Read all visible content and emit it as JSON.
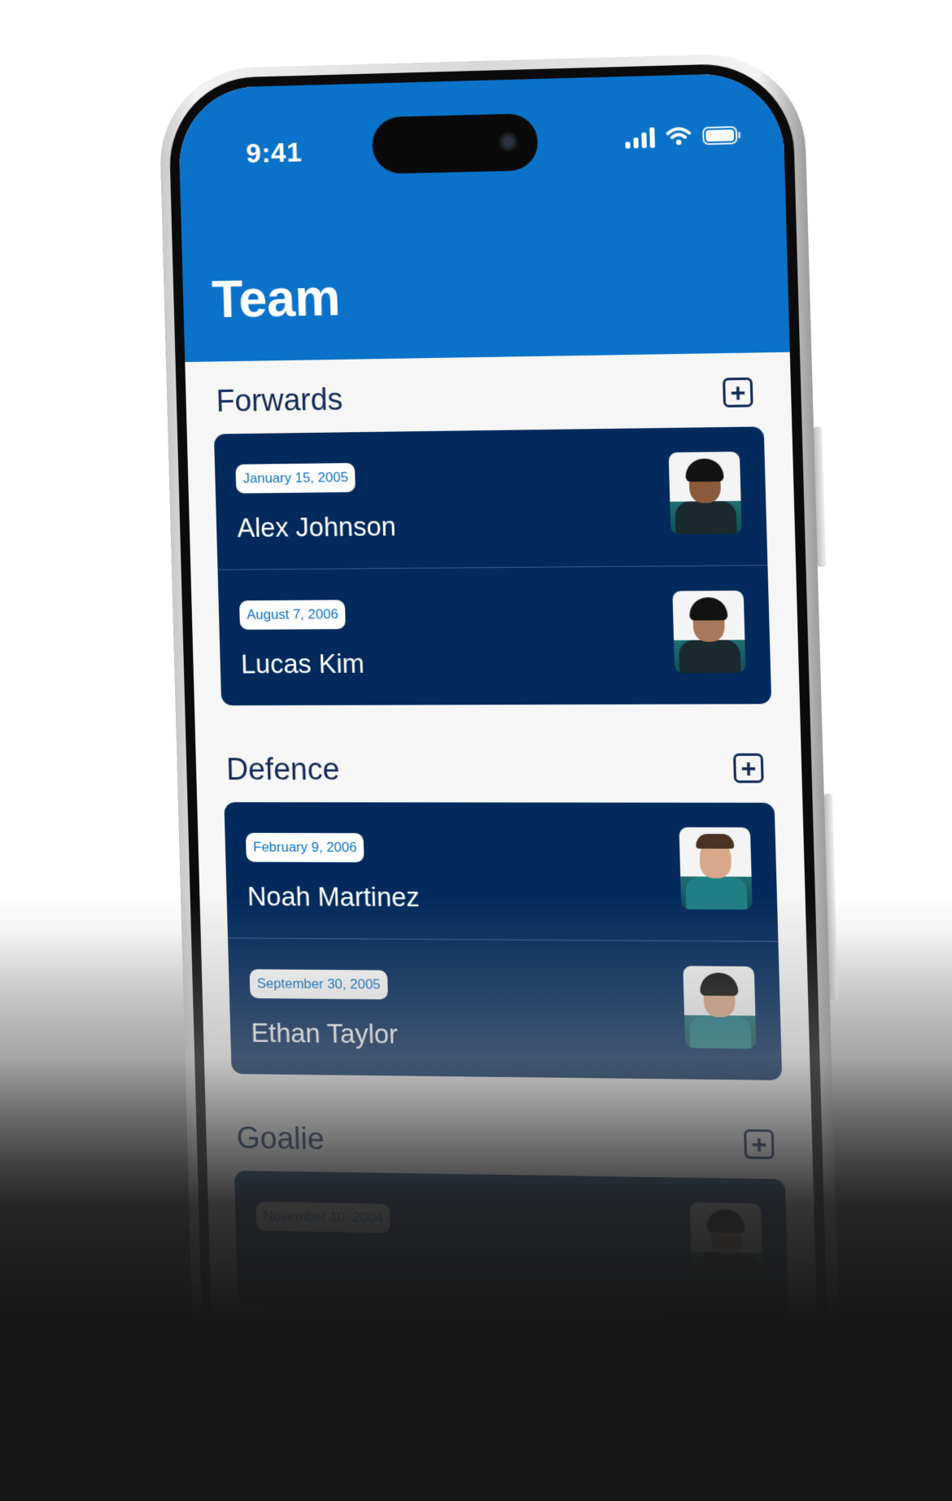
{
  "status_bar": {
    "time": "9:41",
    "icons": [
      "signal-icon",
      "wifi-icon",
      "battery-icon"
    ]
  },
  "header": {
    "title": "Team",
    "color": "#0a72c9"
  },
  "colors": {
    "card": "#022a5c",
    "section_title": "#112a55",
    "badge_text": "#0a72c9"
  },
  "sections": [
    {
      "title": "Forwards",
      "add_icon": "plus-square-icon",
      "players": [
        {
          "dob": "January 15, 2005",
          "name": "Alex Johnson"
        },
        {
          "dob": "August 7, 2006",
          "name": "Lucas Kim"
        }
      ]
    },
    {
      "title": "Defence",
      "add_icon": "plus-square-icon",
      "players": [
        {
          "dob": "February 9, 2006",
          "name": "Noah Martinez"
        },
        {
          "dob": "September 30, 2005",
          "name": "Ethan Taylor"
        }
      ]
    },
    {
      "title": "Goalie",
      "add_icon": "plus-square-icon",
      "players": [
        {
          "dob": "November 10, 2004",
          "name": ""
        }
      ]
    }
  ]
}
